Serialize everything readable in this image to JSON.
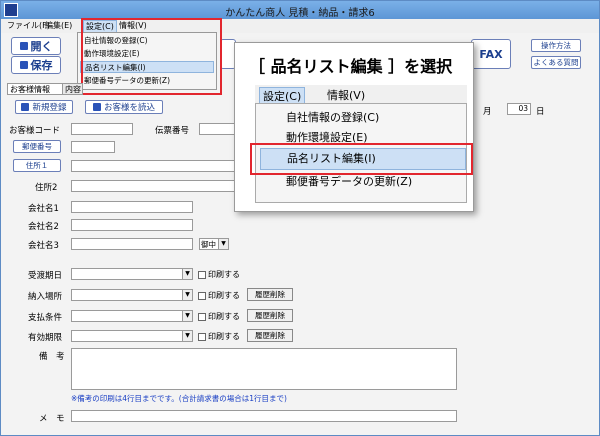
{
  "window": {
    "title": "かんたん商人 見積・納品・請求6"
  },
  "menubar": {
    "file": "ファイル(F)",
    "edit": "編集(E)",
    "settings": "設定(C)",
    "info": "情報(V)"
  },
  "dropdown": {
    "items": [
      "自社情報の登録(C)",
      "動作環境設定(E)",
      "品名リスト編集(I)",
      "郵便番号データの更新(Z)"
    ]
  },
  "toolbar": {
    "open": "開く",
    "save": "保存",
    "fax": "FAX",
    "manual": "操作方法",
    "faq": "よくある質問"
  },
  "tabs": {
    "customer_info": "お客様情報",
    "content": "内容"
  },
  "buttons": {
    "new_register": "新規登録",
    "load_customer": "お客様を読込",
    "postal": "郵便番号",
    "address1": "住所１",
    "clear_history": "履歴削除"
  },
  "labels": {
    "customer_code": "お客様コード",
    "slip_no": "伝票番号",
    "address2": "住所2",
    "company1": "会社名1",
    "company2": "会社名2",
    "company3": "会社名3",
    "delivery_date": "受渡期日",
    "delivery_place": "納入場所",
    "payment": "支払条件",
    "expiry": "有効期限",
    "remarks": "備　考",
    "memo": "メ　モ",
    "print": "印刷する",
    "honorific": "御中",
    "month_suffix": "月",
    "day_value": "03",
    "day_suffix": "日"
  },
  "note": "※備考の印刷は4行目までです。(合計請求書の場合は1行目まで)",
  "callout": {
    "heading": "［ 品名リスト編集 ］を選択",
    "menubar": {
      "settings": "設定(C)",
      "info": "情報(V)"
    },
    "items": [
      "自社情報の登録(C)",
      "動作環境設定(E)",
      "品名リスト編集(I)",
      "郵便番号データの更新(Z)"
    ]
  },
  "colors": {
    "highlight_red": "#e2262e",
    "accent_blue": "#1c3f8f"
  }
}
